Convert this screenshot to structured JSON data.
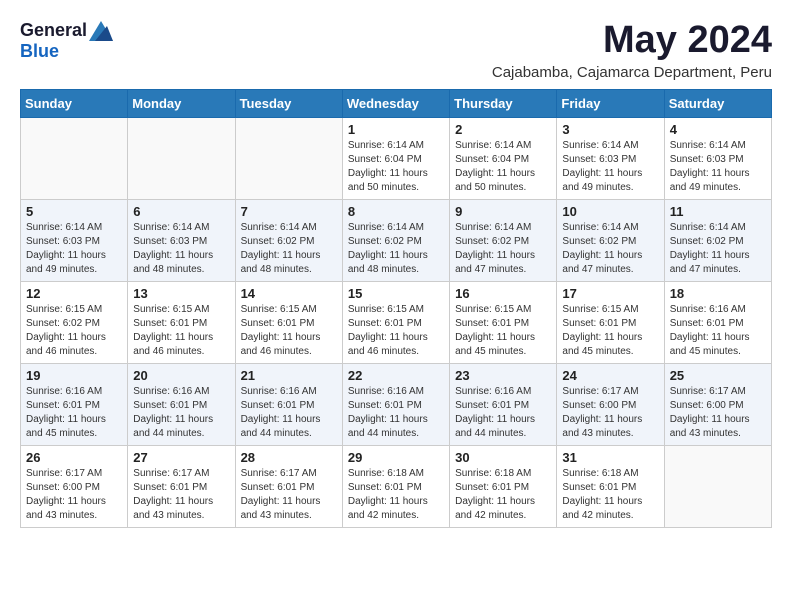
{
  "logo": {
    "general": "General",
    "blue": "Blue"
  },
  "title": {
    "month": "May 2024",
    "location": "Cajabamba, Cajamarca Department, Peru"
  },
  "headers": [
    "Sunday",
    "Monday",
    "Tuesday",
    "Wednesday",
    "Thursday",
    "Friday",
    "Saturday"
  ],
  "weeks": [
    [
      {
        "day": "",
        "info": ""
      },
      {
        "day": "",
        "info": ""
      },
      {
        "day": "",
        "info": ""
      },
      {
        "day": "1",
        "info": "Sunrise: 6:14 AM\nSunset: 6:04 PM\nDaylight: 11 hours\nand 50 minutes."
      },
      {
        "day": "2",
        "info": "Sunrise: 6:14 AM\nSunset: 6:04 PM\nDaylight: 11 hours\nand 50 minutes."
      },
      {
        "day": "3",
        "info": "Sunrise: 6:14 AM\nSunset: 6:03 PM\nDaylight: 11 hours\nand 49 minutes."
      },
      {
        "day": "4",
        "info": "Sunrise: 6:14 AM\nSunset: 6:03 PM\nDaylight: 11 hours\nand 49 minutes."
      }
    ],
    [
      {
        "day": "5",
        "info": "Sunrise: 6:14 AM\nSunset: 6:03 PM\nDaylight: 11 hours\nand 49 minutes."
      },
      {
        "day": "6",
        "info": "Sunrise: 6:14 AM\nSunset: 6:03 PM\nDaylight: 11 hours\nand 48 minutes."
      },
      {
        "day": "7",
        "info": "Sunrise: 6:14 AM\nSunset: 6:02 PM\nDaylight: 11 hours\nand 48 minutes."
      },
      {
        "day": "8",
        "info": "Sunrise: 6:14 AM\nSunset: 6:02 PM\nDaylight: 11 hours\nand 48 minutes."
      },
      {
        "day": "9",
        "info": "Sunrise: 6:14 AM\nSunset: 6:02 PM\nDaylight: 11 hours\nand 47 minutes."
      },
      {
        "day": "10",
        "info": "Sunrise: 6:14 AM\nSunset: 6:02 PM\nDaylight: 11 hours\nand 47 minutes."
      },
      {
        "day": "11",
        "info": "Sunrise: 6:14 AM\nSunset: 6:02 PM\nDaylight: 11 hours\nand 47 minutes."
      }
    ],
    [
      {
        "day": "12",
        "info": "Sunrise: 6:15 AM\nSunset: 6:02 PM\nDaylight: 11 hours\nand 46 minutes."
      },
      {
        "day": "13",
        "info": "Sunrise: 6:15 AM\nSunset: 6:01 PM\nDaylight: 11 hours\nand 46 minutes."
      },
      {
        "day": "14",
        "info": "Sunrise: 6:15 AM\nSunset: 6:01 PM\nDaylight: 11 hours\nand 46 minutes."
      },
      {
        "day": "15",
        "info": "Sunrise: 6:15 AM\nSunset: 6:01 PM\nDaylight: 11 hours\nand 46 minutes."
      },
      {
        "day": "16",
        "info": "Sunrise: 6:15 AM\nSunset: 6:01 PM\nDaylight: 11 hours\nand 45 minutes."
      },
      {
        "day": "17",
        "info": "Sunrise: 6:15 AM\nSunset: 6:01 PM\nDaylight: 11 hours\nand 45 minutes."
      },
      {
        "day": "18",
        "info": "Sunrise: 6:16 AM\nSunset: 6:01 PM\nDaylight: 11 hours\nand 45 minutes."
      }
    ],
    [
      {
        "day": "19",
        "info": "Sunrise: 6:16 AM\nSunset: 6:01 PM\nDaylight: 11 hours\nand 45 minutes."
      },
      {
        "day": "20",
        "info": "Sunrise: 6:16 AM\nSunset: 6:01 PM\nDaylight: 11 hours\nand 44 minutes."
      },
      {
        "day": "21",
        "info": "Sunrise: 6:16 AM\nSunset: 6:01 PM\nDaylight: 11 hours\nand 44 minutes."
      },
      {
        "day": "22",
        "info": "Sunrise: 6:16 AM\nSunset: 6:01 PM\nDaylight: 11 hours\nand 44 minutes."
      },
      {
        "day": "23",
        "info": "Sunrise: 6:16 AM\nSunset: 6:01 PM\nDaylight: 11 hours\nand 44 minutes."
      },
      {
        "day": "24",
        "info": "Sunrise: 6:17 AM\nSunset: 6:00 PM\nDaylight: 11 hours\nand 43 minutes."
      },
      {
        "day": "25",
        "info": "Sunrise: 6:17 AM\nSunset: 6:00 PM\nDaylight: 11 hours\nand 43 minutes."
      }
    ],
    [
      {
        "day": "26",
        "info": "Sunrise: 6:17 AM\nSunset: 6:00 PM\nDaylight: 11 hours\nand 43 minutes."
      },
      {
        "day": "27",
        "info": "Sunrise: 6:17 AM\nSunset: 6:01 PM\nDaylight: 11 hours\nand 43 minutes."
      },
      {
        "day": "28",
        "info": "Sunrise: 6:17 AM\nSunset: 6:01 PM\nDaylight: 11 hours\nand 43 minutes."
      },
      {
        "day": "29",
        "info": "Sunrise: 6:18 AM\nSunset: 6:01 PM\nDaylight: 11 hours\nand 42 minutes."
      },
      {
        "day": "30",
        "info": "Sunrise: 6:18 AM\nSunset: 6:01 PM\nDaylight: 11 hours\nand 42 minutes."
      },
      {
        "day": "31",
        "info": "Sunrise: 6:18 AM\nSunset: 6:01 PM\nDaylight: 11 hours\nand 42 minutes."
      },
      {
        "day": "",
        "info": ""
      }
    ]
  ]
}
